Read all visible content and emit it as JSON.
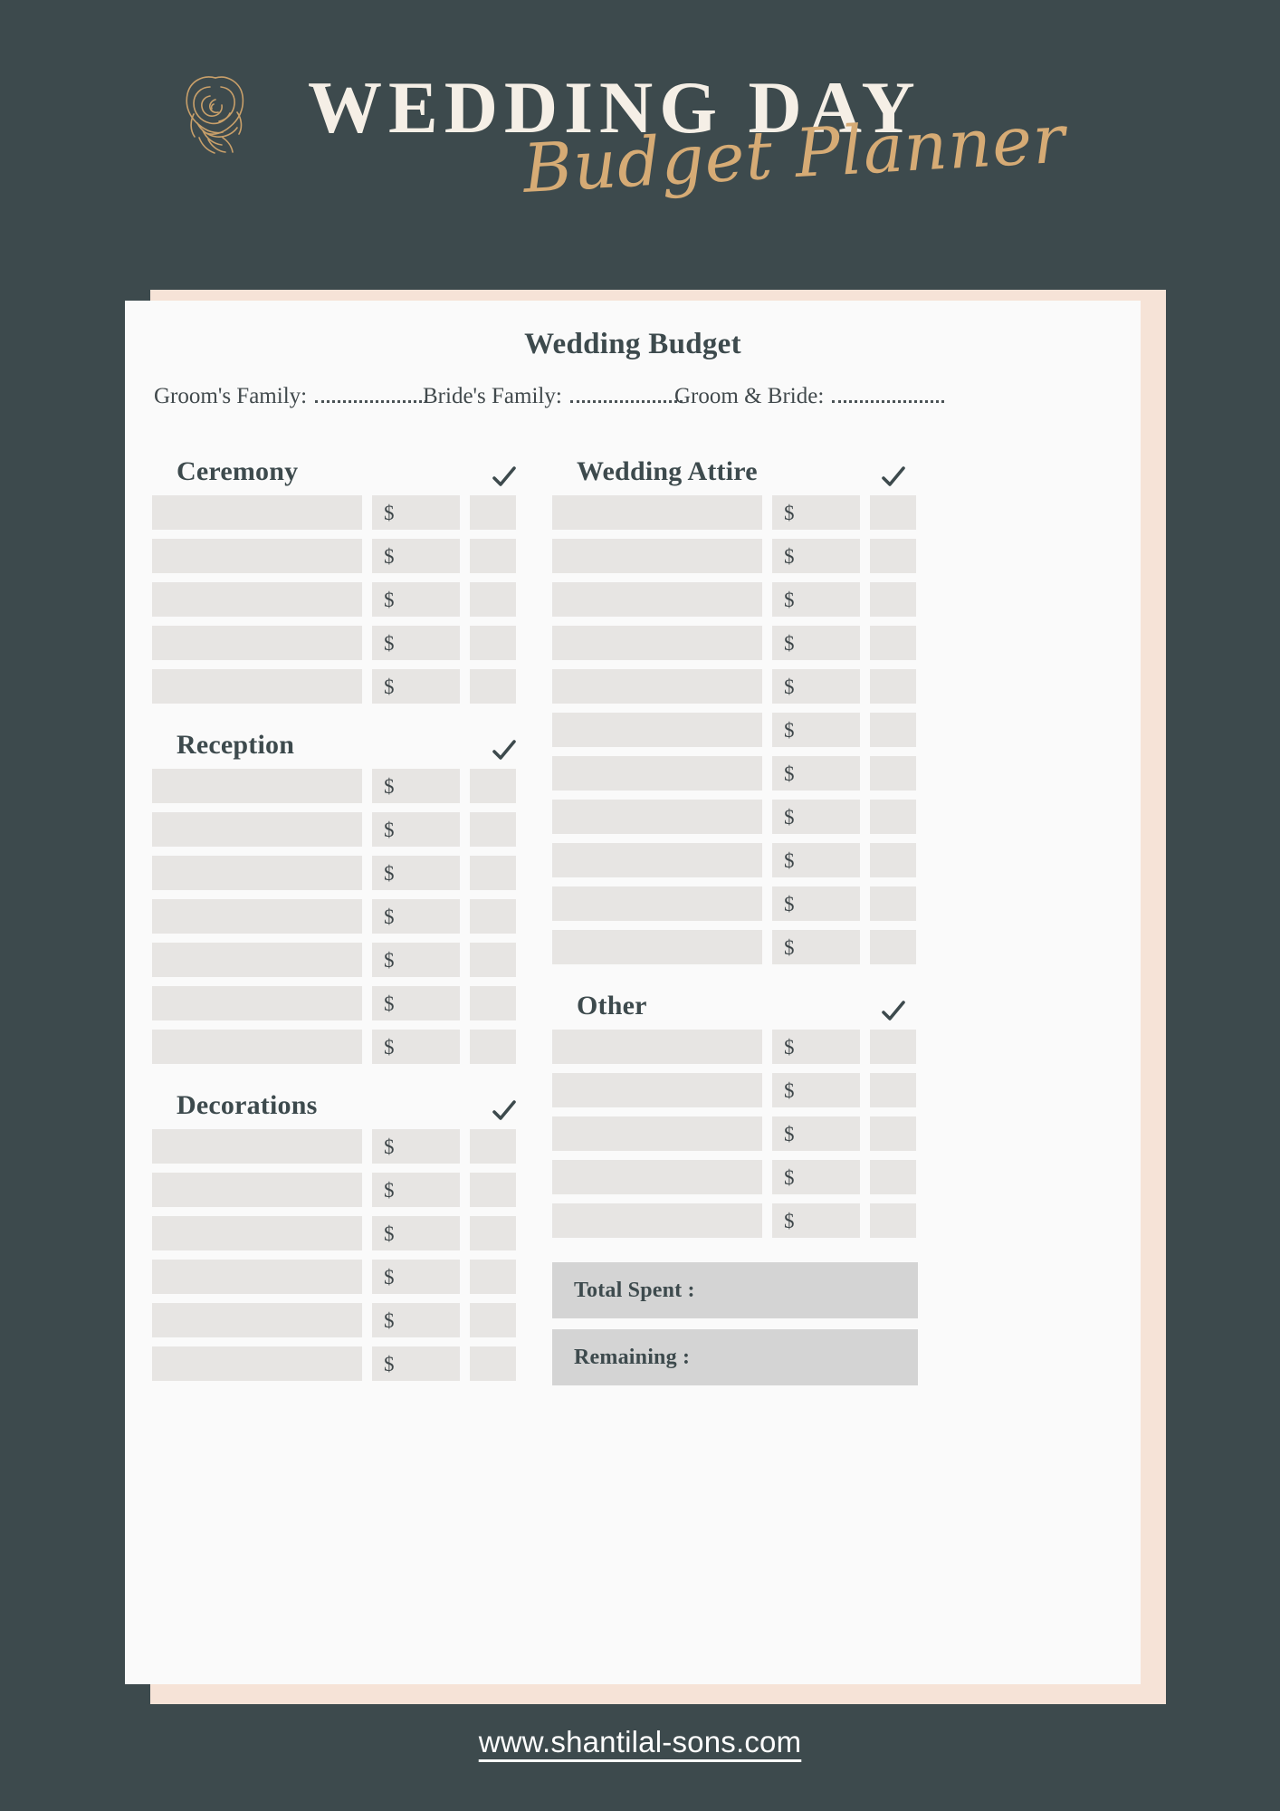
{
  "header": {
    "title_main": "WEDDING DAY",
    "title_script": "Budget Planner",
    "rose_icon": "rose-icon",
    "colors": {
      "background": "#3d4a4d",
      "gold": "#d6ab75",
      "cream": "#f5efe6"
    }
  },
  "card": {
    "title": "Wedding Budget",
    "fields": [
      {
        "label": "Groom's Family:",
        "value": ""
      },
      {
        "label": "Bride's Family:",
        "value": ""
      },
      {
        "label": "Groom & Bride:",
        "value": ""
      }
    ],
    "currency_symbol": "$",
    "check_icon": "check-icon",
    "left_column": [
      {
        "title": "Ceremony",
        "rows": 5,
        "checked": true
      },
      {
        "title": "Reception",
        "rows": 7,
        "checked": true
      },
      {
        "title": "Decorations",
        "rows": 6,
        "checked": true
      }
    ],
    "right_column": [
      {
        "title": "Wedding Attire",
        "rows": 11,
        "checked": true
      },
      {
        "title": "Other",
        "rows": 5,
        "checked": true
      }
    ],
    "totals": [
      {
        "label": "Total Spent :",
        "value": ""
      },
      {
        "label": "Remaining :",
        "value": ""
      }
    ],
    "colors": {
      "card_bg": "#fafafa",
      "card_shadow": "#f6e3d7",
      "input_fill": "#e7e5e3",
      "total_fill": "#d4d4d4",
      "text": "#3d4a4d"
    }
  },
  "footer": {
    "url": "www.shantilal-sons.com"
  }
}
